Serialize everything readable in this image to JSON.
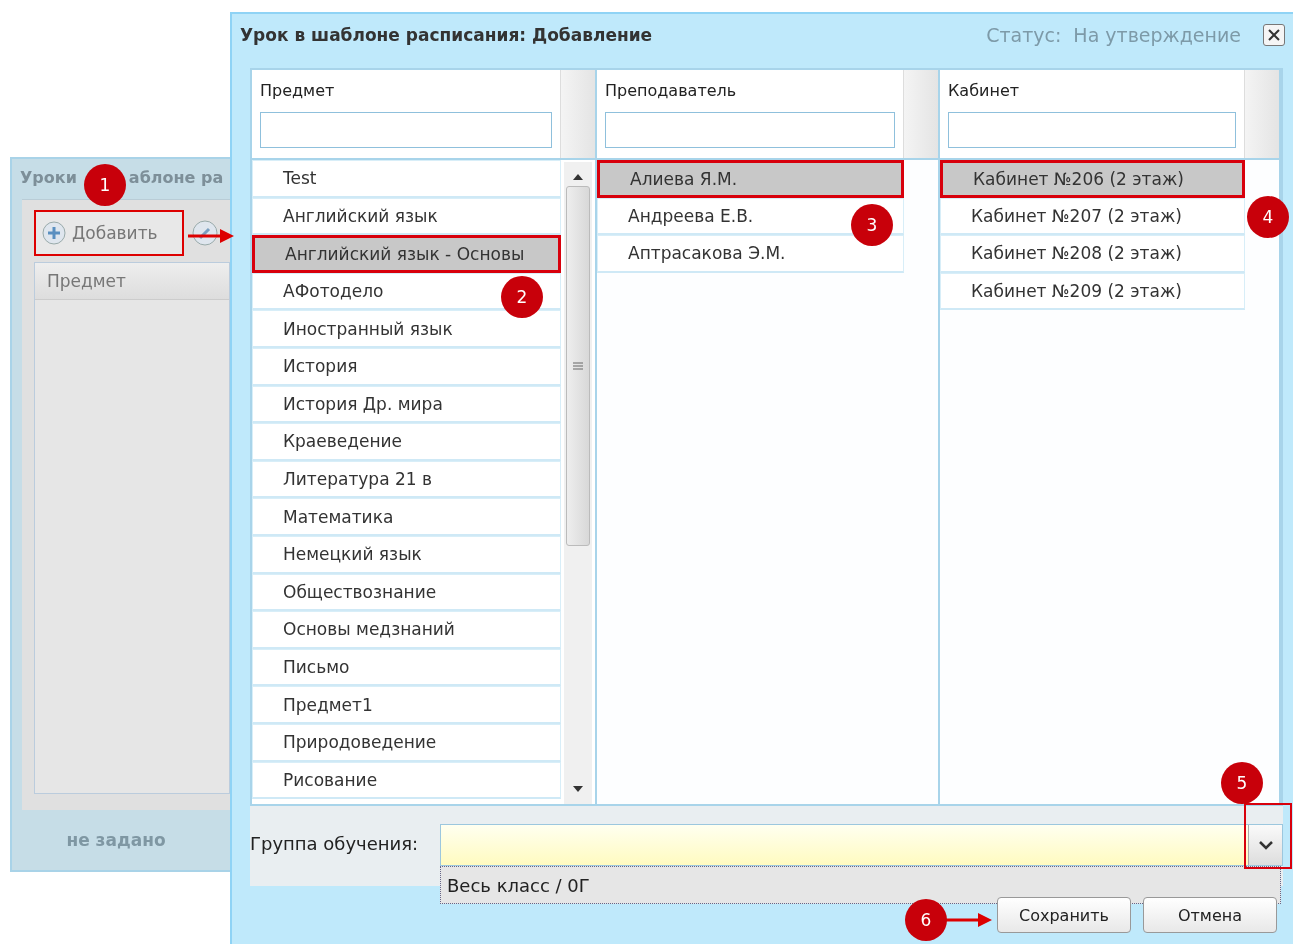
{
  "background_window": {
    "title_parts": [
      "Уроки",
      "аблоне ра"
    ],
    "add_button": "Добавить",
    "column_header": "Предмет",
    "footer_text": "не задано"
  },
  "dialog": {
    "title": "Урок в шаблоне расписания: Добавление",
    "background_texts": [
      "Статус:",
      "На утверждение"
    ],
    "columns": [
      {
        "header": "Предмет",
        "scrollbar": true,
        "rows": [
          {
            "label": "Test",
            "selected": false
          },
          {
            "label": "Английский язык",
            "selected": false
          },
          {
            "label": "Английский язык - Основы",
            "selected": true
          },
          {
            "label": "АФотодело",
            "selected": false
          },
          {
            "label": "Иностранный язык",
            "selected": false
          },
          {
            "label": "История",
            "selected": false
          },
          {
            "label": "История Др. мира",
            "selected": false
          },
          {
            "label": "Краеведение",
            "selected": false
          },
          {
            "label": "Литература 21 в",
            "selected": false
          },
          {
            "label": "Математика",
            "selected": false
          },
          {
            "label": "Немецкий язык",
            "selected": false
          },
          {
            "label": "Обществознание",
            "selected": false
          },
          {
            "label": "Основы медзнаний",
            "selected": false
          },
          {
            "label": "Письмо",
            "selected": false
          },
          {
            "label": "Предмет1",
            "selected": false
          },
          {
            "label": "Природоведение",
            "selected": false
          },
          {
            "label": "Рисование",
            "selected": false
          }
        ]
      },
      {
        "header": "Преподаватель",
        "scrollbar": false,
        "rows": [
          {
            "label": "Алиева Я.М.",
            "selected": true
          },
          {
            "label": "Андреева Е.В.",
            "selected": false
          },
          {
            "label": "Аптрасакова Э.М.",
            "selected": false
          }
        ]
      },
      {
        "header": "Кабинет",
        "scrollbar": false,
        "rows": [
          {
            "label": "Кабинет №206 (2 этаж)",
            "selected": true
          },
          {
            "label": "Кабинет №207 (2 этаж)",
            "selected": false
          },
          {
            "label": "Кабинет №208 (2 этаж)",
            "selected": false
          },
          {
            "label": "Кабинет №209 (2 этаж)",
            "selected": false
          }
        ]
      }
    ],
    "group_field": {
      "label": "Группа обучения:",
      "options": [
        {
          "label": "Весь класс / 0Г"
        }
      ]
    },
    "buttons": [
      "Сохранить",
      "Отмена"
    ]
  },
  "annotations": [
    "1",
    "2",
    "3",
    "4",
    "5",
    "6"
  ]
}
